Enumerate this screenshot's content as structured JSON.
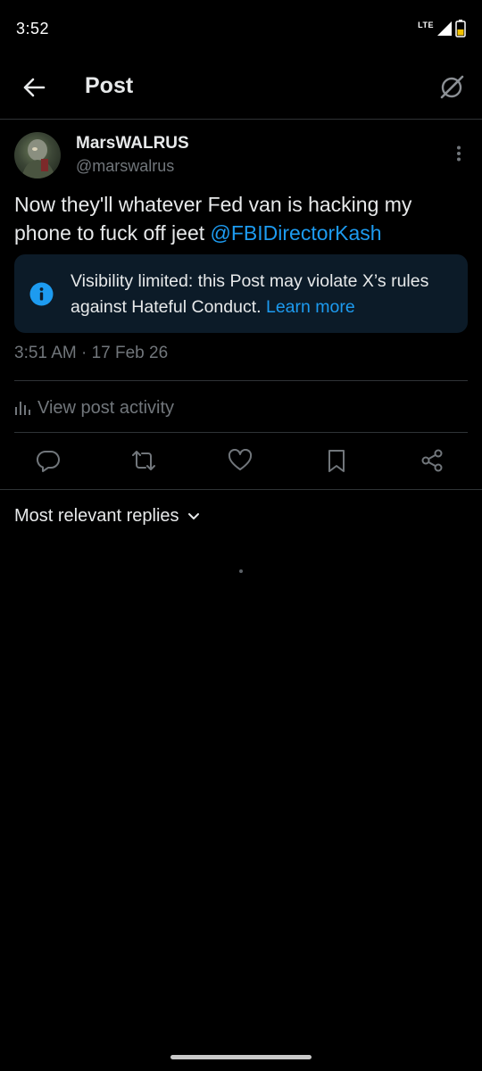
{
  "status_bar": {
    "time": "3:52",
    "network": "LTE"
  },
  "header": {
    "title": "Post"
  },
  "post": {
    "author": {
      "display_name": "MarsWALRUS",
      "handle": "@marswalrus"
    },
    "text_body": "Now they'll whatever Fed van is hacking my phone to fuck off jeet ",
    "mention": "@FBIDirectorKash",
    "notice": {
      "text": "Visibility limited: this Post may violate X’s rules against Hateful Conduct. ",
      "link": "Learn more"
    },
    "timestamp": "3:51 AM · 17 Feb 26",
    "activity_label": "View post activity"
  },
  "actions": {
    "icons": [
      "reply-icon",
      "repost-icon",
      "like-icon",
      "bookmark-icon",
      "share-icon"
    ]
  },
  "replies": {
    "sort_label": "Most relevant replies"
  },
  "colors": {
    "background": "#000000",
    "text_primary": "#e7e9ea",
    "text_secondary": "#71767b",
    "accent": "#1d9bf0",
    "notice_bg": "#0c1b28",
    "divider": "#2f3336"
  }
}
